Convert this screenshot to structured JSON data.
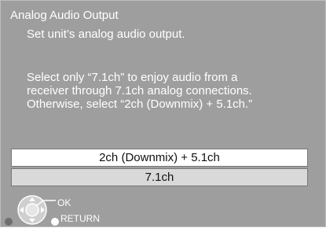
{
  "header": {
    "title": "Analog Audio Output",
    "subtitle": "Set unit’s analog audio output."
  },
  "description": {
    "lines": [
      "Select only “7.1ch” to enjoy audio from a",
      "receiver through 7.1ch analog connections.",
      "Otherwise, select “2ch (Downmix) + 5.1ch.”"
    ]
  },
  "options": [
    {
      "label": "2ch (Downmix) + 5.1ch",
      "selected": true
    },
    {
      "label": "7.1ch",
      "selected": false
    }
  ],
  "hints": {
    "ok_label": "OK",
    "return_label": "RETURN",
    "dpad_icon": "dpad-icon",
    "ok_icon": "ok-button-icon",
    "return_icon": "return-button-icon"
  },
  "colors": {
    "background": "#9e9e9e",
    "selected_option_bg": "#ffffff",
    "option_bg": "#d9d9d9",
    "text": "#ffffff"
  }
}
